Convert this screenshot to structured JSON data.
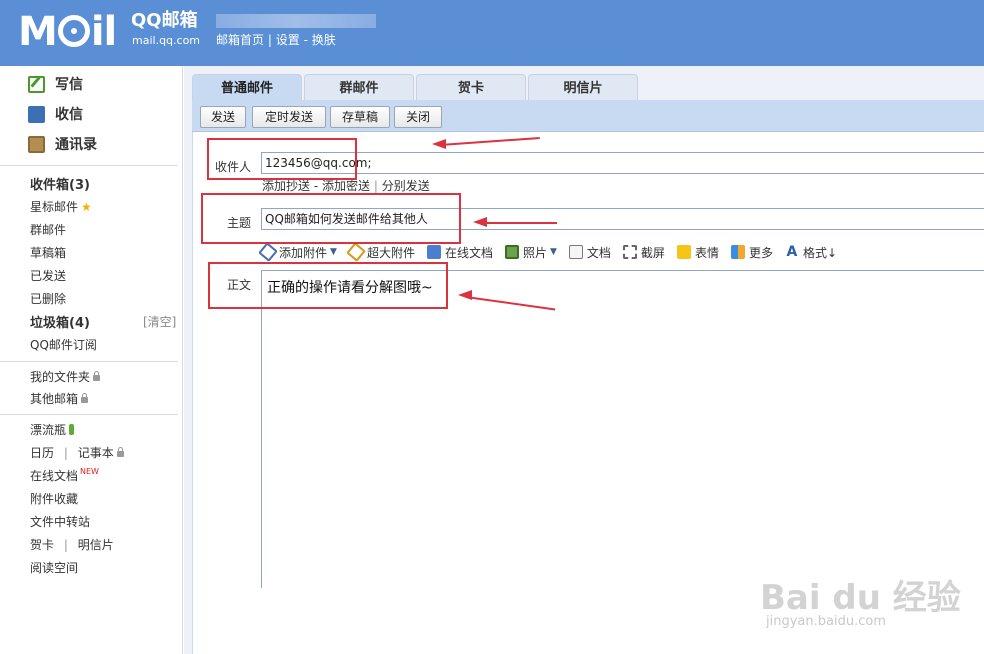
{
  "header": {
    "logo_mail": "M il",
    "logo_product": "QQ邮箱",
    "logo_url": "mail.qq.com",
    "links": {
      "home": "邮箱首页",
      "sep": "|",
      "settings": "设置",
      "dash": "-",
      "skin": "换肤"
    }
  },
  "sidebar": {
    "actions": {
      "write": "写信",
      "inbox": "收信",
      "contacts": "通讯录"
    },
    "folders": {
      "inbox": "收件箱(3)",
      "starred": "星标邮件",
      "group": "群邮件",
      "drafts": "草稿箱",
      "sent": "已发送",
      "deleted": "已删除",
      "spam": "垃圾箱(4)",
      "spam_clear": "[清空]",
      "subscribe": "QQ邮件订阅"
    },
    "my_folders": {
      "mine": "我的文件夹",
      "other": "其他邮箱"
    },
    "apps": {
      "bottle": "漂流瓶",
      "calendar": "日历",
      "bar": "|",
      "notes": "记事本",
      "docs": "在线文档",
      "new_badge": "NEW",
      "attachments": "附件收藏",
      "transfer": "文件中转站",
      "card": "贺卡",
      "postcard": "明信片",
      "reading": "阅读空间"
    }
  },
  "tabs": [
    "普通邮件",
    "群邮件",
    "贺卡",
    "明信片"
  ],
  "toolbar": {
    "send": "发送",
    "schedule": "定时发送",
    "save_draft": "存草稿",
    "close": "关闭"
  },
  "compose": {
    "to_label": "收件人",
    "to_value": "123456@qq.com;",
    "cc": "添加抄送",
    "bcc": "添加密送",
    "split": "分别发送",
    "dash": "-",
    "bar": "|",
    "subject_label": "主题",
    "subject_value": "QQ邮箱如何发送邮件给其他人",
    "body_label": "正文",
    "body_value": "正确的操作请看分解图哦~"
  },
  "attach_bar": {
    "attach": "添加附件",
    "big": "超大附件",
    "docs": "在线文档",
    "photo": "照片",
    "file": "文档",
    "screenshot": "截屏",
    "emoji": "表情",
    "more": "更多",
    "format": "格式↓"
  },
  "watermark": {
    "brand": "Bai du 经验",
    "url": "jingyan.baidu.com"
  },
  "colors": {
    "header": "#5a8fd6",
    "toolbar": "#c7daf2",
    "annotation": "#d9333f"
  }
}
